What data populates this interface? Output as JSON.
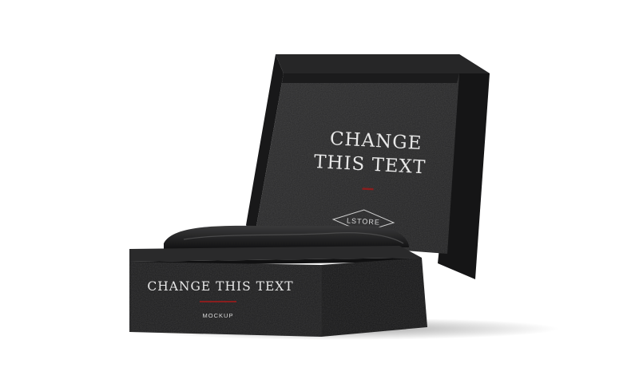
{
  "lid": {
    "headline_line1": "CHANGE",
    "headline_line2": "THIS TEXT",
    "badge_text": "LSTORE"
  },
  "base": {
    "headline": "CHANGE THIS TEXT",
    "subtext": "MOCKUP"
  },
  "colors": {
    "box": "#1e1e1f",
    "box_dark": "#141415",
    "accent_rule": "#8a1e1e",
    "print": "#e8e8e8"
  }
}
